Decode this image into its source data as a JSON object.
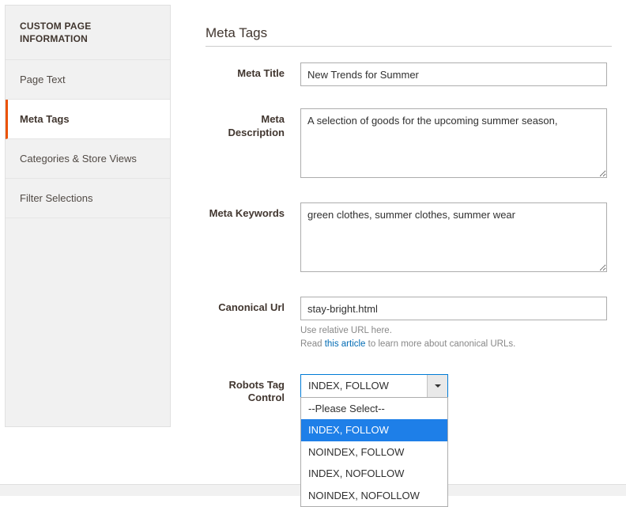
{
  "sidebar": {
    "title": "CUSTOM PAGE INFORMATION",
    "items": [
      {
        "label": "Page Text"
      },
      {
        "label": "Meta Tags"
      },
      {
        "label": "Categories & Store Views"
      },
      {
        "label": "Filter Selections"
      }
    ],
    "active_index": 1
  },
  "section": {
    "title": "Meta Tags"
  },
  "fields": {
    "meta_title": {
      "label": "Meta Title",
      "value": "New Trends for Summer"
    },
    "meta_description": {
      "label": "Meta Description",
      "value": "A selection of goods for the upcoming summer season,"
    },
    "meta_keywords": {
      "label": "Meta Keywords",
      "value": "green clothes, summer clothes, summer wear"
    },
    "canonical_url": {
      "label": "Canonical Url",
      "value": "stay-bright.html",
      "hint_prefix": "Use relative URL here.",
      "hint_read": "Read ",
      "hint_link": "this article",
      "hint_suffix": " to learn more about canonical URLs."
    },
    "robots": {
      "label": "Robots Tag Control",
      "value": "INDEX, FOLLOW",
      "options": [
        "--Please Select--",
        "INDEX, FOLLOW",
        "NOINDEX, FOLLOW",
        "INDEX, NOFOLLOW",
        "NOINDEX, NOFOLLOW"
      ],
      "selected_index": 1
    }
  }
}
